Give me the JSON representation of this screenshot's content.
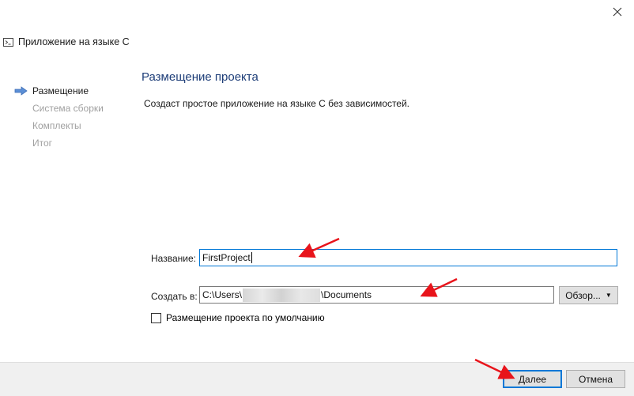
{
  "window": {
    "title": "Приложение на языке C",
    "icon": "console-icon",
    "close_icon": "close-icon"
  },
  "steps": [
    {
      "label": "Размещение",
      "active": true
    },
    {
      "label": "Система сборки",
      "active": false
    },
    {
      "label": "Комплекты",
      "active": false
    },
    {
      "label": "Итог",
      "active": false
    }
  ],
  "page": {
    "heading": "Размещение проекта",
    "description": "Создаст простое приложение на языке C без зависимостей."
  },
  "form": {
    "name_label": "Название:",
    "name_value": "FirstProject",
    "location_label": "Создать в:",
    "location_prefix": "C:\\Users\\",
    "location_suffix": "\\Documents",
    "browse_label": "Обзор...",
    "default_location_label": "Размещение проекта по умолчанию",
    "default_location_checked": false
  },
  "footer": {
    "next_label": "Далее",
    "cancel_label": "Отмена"
  },
  "colors": {
    "heading": "#1d3d78",
    "focus_border": "#0078d7",
    "annotation_arrow": "#e8141b",
    "step_arrow": "#5b8fd6"
  }
}
